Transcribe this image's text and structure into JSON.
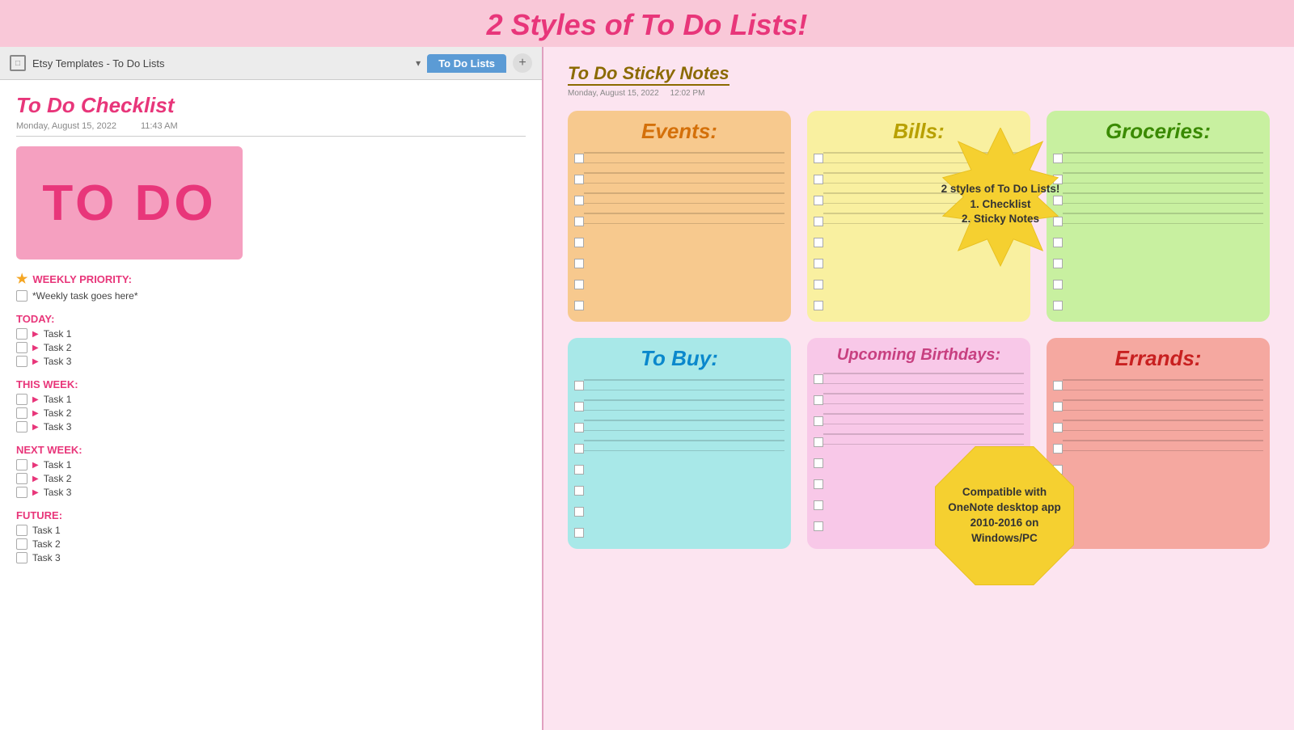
{
  "banner": {
    "title": "2 Styles of To Do Lists!"
  },
  "left": {
    "browser": {
      "title": "Etsy Templates - To Do Lists",
      "tab_label": "To Do Lists",
      "tab_add": "+"
    },
    "checklist": {
      "title": "To Do Checklist",
      "date": "Monday, August 15, 2022",
      "time": "11:43 AM",
      "hero_text": "TO DO",
      "sections": [
        {
          "id": "weekly",
          "label": "WEEKLY PRIORITY:",
          "has_star": true,
          "tasks": [
            "*Weekly task goes here*"
          ]
        },
        {
          "id": "today",
          "label": "TODAY:",
          "has_star": false,
          "tasks": [
            "Task 1",
            "Task 2",
            "Task 3"
          ]
        },
        {
          "id": "this-week",
          "label": "THIS WEEK:",
          "has_star": false,
          "tasks": [
            "Task 1",
            "Task 2",
            "Task 3"
          ]
        },
        {
          "id": "next-week",
          "label": "NEXT WEEK:",
          "has_star": false,
          "tasks": [
            "Task 1",
            "Task 2",
            "Task 3"
          ]
        },
        {
          "id": "future",
          "label": "FUTURE:",
          "has_star": false,
          "tasks": [
            "Task 1",
            "Task 2",
            "Task 3"
          ]
        }
      ]
    }
  },
  "right": {
    "sticky_notes_title": "To Do Sticky Notes",
    "sticky_notes_date": "Monday, August 15, 2022",
    "sticky_notes_time": "12:02 PM",
    "notes": [
      {
        "id": "events",
        "title": "Events:",
        "color_class": "note-orange",
        "title_color": "title-orange"
      },
      {
        "id": "bills",
        "title": "Bills:",
        "color_class": "note-yellow",
        "title_color": "title-yellow"
      },
      {
        "id": "groceries",
        "title": "Groceries:",
        "color_class": "note-green",
        "title_color": "title-green"
      },
      {
        "id": "to-buy",
        "title": "To Buy:",
        "color_class": "note-blue",
        "title_color": "title-blue"
      },
      {
        "id": "birthdays",
        "title": "Upcoming Birthdays:",
        "color_class": "note-pink-light",
        "title_color": "title-pink"
      },
      {
        "id": "errands",
        "title": "Errands:",
        "color_class": "note-red-light",
        "title_color": "title-red"
      }
    ],
    "starburst": {
      "text": "2 styles of To Do Lists!\n1. Checklist\n2. Sticky Notes"
    },
    "octagon": {
      "text": "Compatible with OneNote desktop app 2010-2016 on Windows/PC"
    }
  }
}
